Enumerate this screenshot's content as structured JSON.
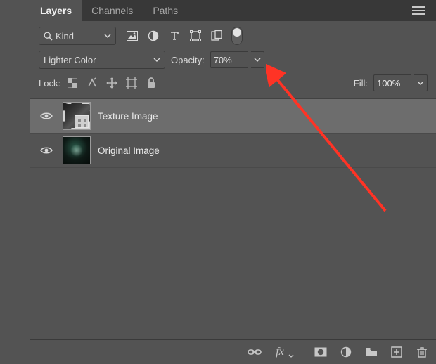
{
  "tabs": {
    "layers": "Layers",
    "channels": "Channels",
    "paths": "Paths"
  },
  "filter": {
    "kind": "Kind"
  },
  "blend": {
    "mode": "Lighter Color",
    "opacity_label": "Opacity:",
    "opacity_value": "70%",
    "fill_label": "Fill:",
    "fill_value": "100%"
  },
  "lock": {
    "label": "Lock:"
  },
  "layers": [
    {
      "name": "Texture Image"
    },
    {
      "name": "Original Image"
    }
  ],
  "icons": {
    "search": "search-icon",
    "menu": "panel-menu-icon"
  }
}
